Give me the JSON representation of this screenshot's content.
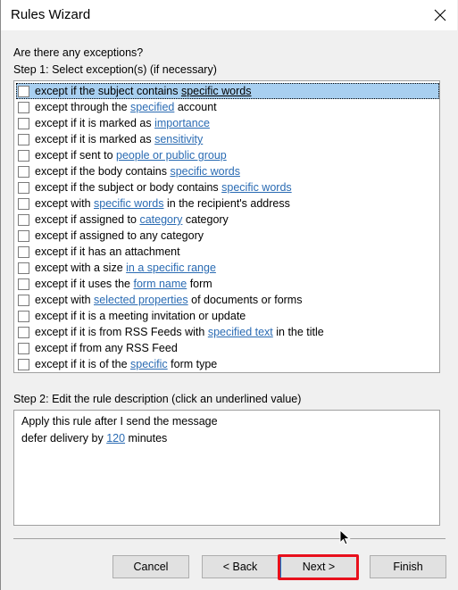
{
  "window": {
    "title": "Rules Wizard",
    "close_icon": "close-icon"
  },
  "prompt": "Are there any exceptions?",
  "step1_label": "Step 1: Select exception(s) (if necessary)",
  "exceptions": [
    {
      "parts": [
        {
          "t": "except if the subject contains "
        },
        {
          "t": "specific words",
          "link": true
        }
      ],
      "checked": false,
      "selected": true
    },
    {
      "parts": [
        {
          "t": "except through the "
        },
        {
          "t": "specified",
          "link": true
        },
        {
          "t": " account"
        }
      ],
      "checked": false
    },
    {
      "parts": [
        {
          "t": "except if it is marked as "
        },
        {
          "t": "importance",
          "link": true
        }
      ],
      "checked": false
    },
    {
      "parts": [
        {
          "t": "except if it is marked as "
        },
        {
          "t": "sensitivity",
          "link": true
        }
      ],
      "checked": false
    },
    {
      "parts": [
        {
          "t": "except if sent to "
        },
        {
          "t": "people or public group",
          "link": true
        }
      ],
      "checked": false
    },
    {
      "parts": [
        {
          "t": "except if the body contains "
        },
        {
          "t": "specific words",
          "link": true
        }
      ],
      "checked": false
    },
    {
      "parts": [
        {
          "t": "except if the subject or body contains "
        },
        {
          "t": "specific words",
          "link": true
        }
      ],
      "checked": false
    },
    {
      "parts": [
        {
          "t": "except with "
        },
        {
          "t": "specific words",
          "link": true
        },
        {
          "t": " in the recipient's address"
        }
      ],
      "checked": false
    },
    {
      "parts": [
        {
          "t": "except if assigned to "
        },
        {
          "t": "category",
          "link": true
        },
        {
          "t": " category"
        }
      ],
      "checked": false
    },
    {
      "parts": [
        {
          "t": "except if assigned to any category"
        }
      ],
      "checked": false
    },
    {
      "parts": [
        {
          "t": "except if it has an attachment"
        }
      ],
      "checked": false
    },
    {
      "parts": [
        {
          "t": "except with a size "
        },
        {
          "t": "in a specific range",
          "link": true
        }
      ],
      "checked": false
    },
    {
      "parts": [
        {
          "t": "except if it uses the "
        },
        {
          "t": "form name",
          "link": true
        },
        {
          "t": " form"
        }
      ],
      "checked": false
    },
    {
      "parts": [
        {
          "t": "except with "
        },
        {
          "t": "selected properties",
          "link": true
        },
        {
          "t": " of documents or forms"
        }
      ],
      "checked": false
    },
    {
      "parts": [
        {
          "t": "except if it is a meeting invitation or update"
        }
      ],
      "checked": false
    },
    {
      "parts": [
        {
          "t": "except if it is from RSS Feeds with "
        },
        {
          "t": "specified text",
          "link": true
        },
        {
          "t": " in the title"
        }
      ],
      "checked": false
    },
    {
      "parts": [
        {
          "t": "except if from any RSS Feed"
        }
      ],
      "checked": false
    },
    {
      "parts": [
        {
          "t": "except if it is of the "
        },
        {
          "t": "specific",
          "link": true
        },
        {
          "t": " form type"
        }
      ],
      "checked": false
    }
  ],
  "step2_label": "Step 2: Edit the rule description (click an underlined value)",
  "description": {
    "line1": "Apply this rule after I send the message",
    "line2_prefix": "defer delivery by ",
    "line2_value": "120",
    "line2_suffix": " minutes"
  },
  "buttons": {
    "cancel": "Cancel",
    "back": "< Back",
    "next": "Next >",
    "finish": "Finish"
  },
  "highlight_color": "#e8101c",
  "link_color": "#2a6bb3"
}
